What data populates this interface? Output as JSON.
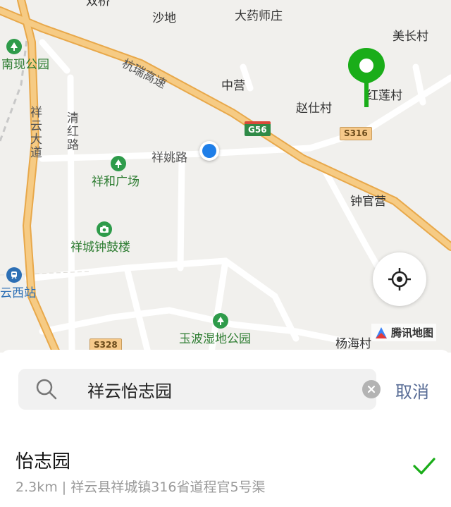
{
  "map": {
    "place_labels": {
      "shuangqiao": "双桥",
      "shadi": "沙地",
      "dayaoshizhuang": "大药师庄",
      "meichangcun": "美长村",
      "nanxian_park": "南现公园",
      "hangrui_expressway": "杭瑞高速",
      "zhongying": "中营",
      "hongliancun": "红莲村",
      "zhaoshicun": "赵仕村",
      "xiangyun_avenue": "祥云大道",
      "qinghong_road": "清红路",
      "xiangyao_road": "祥姚路",
      "xianghe_square": "祥和广场",
      "zhongguanying": "钟官营",
      "xiangcheng_bell_drum_tower": "祥城钟鼓楼",
      "yunxi_station": "云西站",
      "yubo_wetland_park": "玉波湿地公园",
      "yanghaicun": "杨海村"
    },
    "shields": {
      "g56": "G56",
      "s316": "S316",
      "s328": "S328"
    },
    "logo_text": "腾讯地图",
    "colors": {
      "expressway": "#f0b35a",
      "road": "#ffffff",
      "park": "#2e9b4a",
      "pin": "#1aad19",
      "location": "#1e7ee8"
    }
  },
  "search": {
    "query": "祥云怡志园",
    "cancel_label": "取消"
  },
  "results": [
    {
      "title": "怡志园",
      "subtitle": "2.3km | 祥云县祥城镇316省道程官5号渠",
      "selected": true
    }
  ]
}
